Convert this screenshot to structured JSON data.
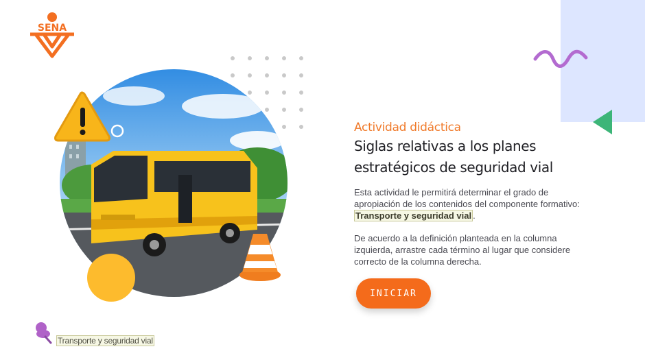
{
  "brand": {
    "logo_text": "SENA",
    "color": "#f36f21"
  },
  "activity": {
    "kicker": "Actividad didáctica",
    "title": "Siglas relativas a los planes estratégicos de seguridad vial",
    "para1_prefix": "Esta actividad le permitirá determinar el grado de apropiación de los contenidos del componente formativo: ",
    "para1_highlight": "Transporte y seguridad vial",
    "para1_suffix": ".",
    "para2": "De acuerdo a la definición planteada en la columna izquierda, arrastre cada término al lugar que considere correcto de la columna derecha.",
    "start_label": "INICIAR"
  },
  "footer": {
    "component_name": "Transporte y seguridad vial"
  },
  "colors": {
    "accent": "#f46b1b",
    "wave": "#b36bd0",
    "triangle": "#3cb578",
    "panel": "#dde6ff",
    "yellow": "#fdbb2d"
  },
  "icons": {
    "logo": "sena-logo",
    "wave": "wave-icon",
    "triangle": "triangle-icon",
    "warning": "warning-icon",
    "cone": "traffic-cone-icon",
    "pin": "pushpin-icon"
  }
}
